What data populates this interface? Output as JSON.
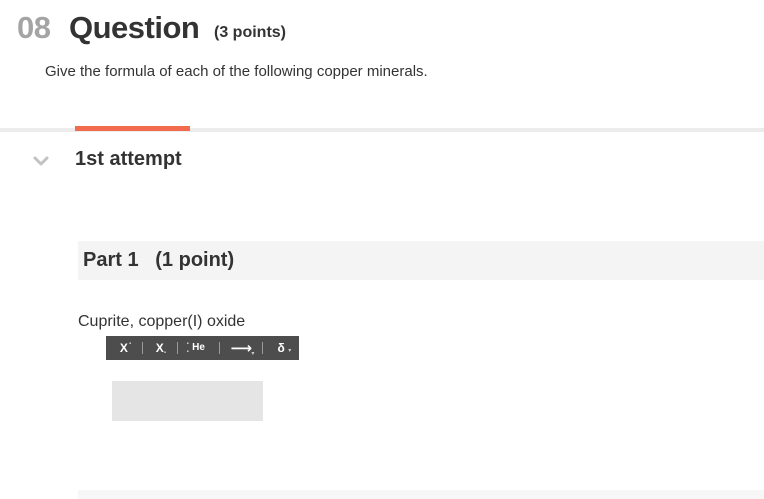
{
  "question": {
    "number": "08",
    "title": "Question",
    "points": "(3 points)",
    "prompt": "Give the formula of each of the following copper minerals."
  },
  "attempt": {
    "label": "1st attempt"
  },
  "part": {
    "label": "Part 1   (1 point)",
    "prompt": "Cuprite, copper(I) oxide"
  },
  "toolbar": {
    "superscript": "X",
    "subscript": "X",
    "element": "He",
    "arrow": "⟶",
    "delta": "δ"
  },
  "answer": {
    "value": ""
  },
  "colors": {
    "accent_tab": "#f26b4f",
    "toolbar_bg": "#4d4d4d",
    "question_number": "#a4a4a4"
  }
}
